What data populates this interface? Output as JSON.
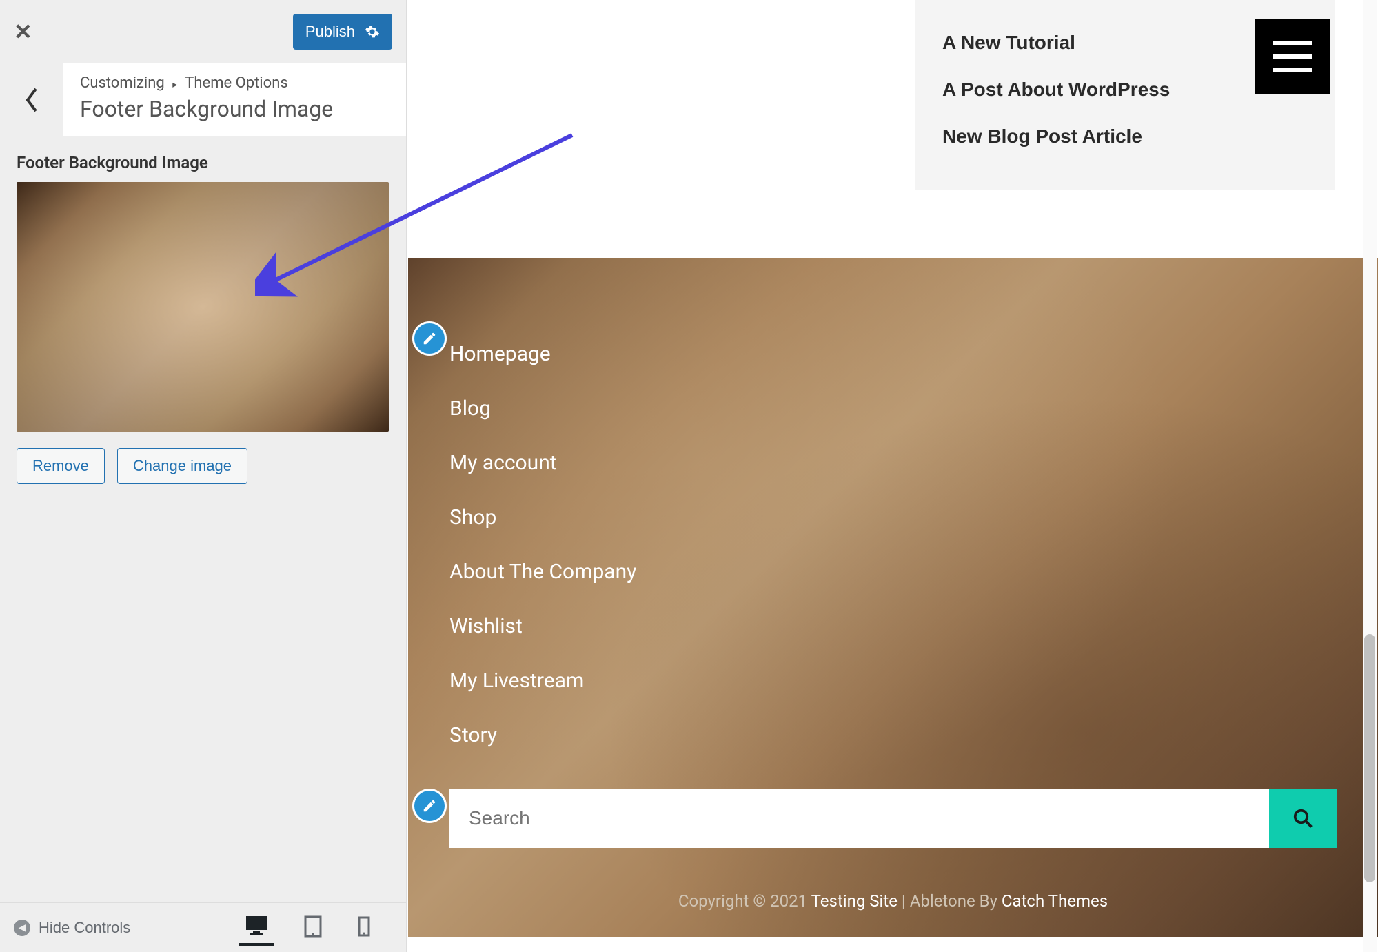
{
  "sidebar": {
    "publish_label": "Publish",
    "breadcrumb_customizing": "Customizing",
    "breadcrumb_section": "Theme Options",
    "section_title": "Footer Background Image",
    "field_label": "Footer Background Image",
    "remove_label": "Remove",
    "change_label": "Change image",
    "hide_controls_label": "Hide Controls"
  },
  "preview": {
    "blog_items": [
      "A New Tutorial",
      "A Post About WordPress",
      "New Blog Post Article"
    ],
    "footer_menu": [
      "Homepage",
      "Blog",
      "My account",
      "Shop",
      "About The Company",
      "Wishlist",
      "My Livestream",
      "Story"
    ],
    "search_placeholder": "Search",
    "copyright_prefix": "Copyright © 2021 ",
    "copyright_site": "Testing Site",
    "copyright_mid": " | Abletone By ",
    "copyright_theme": "Catch Themes"
  }
}
